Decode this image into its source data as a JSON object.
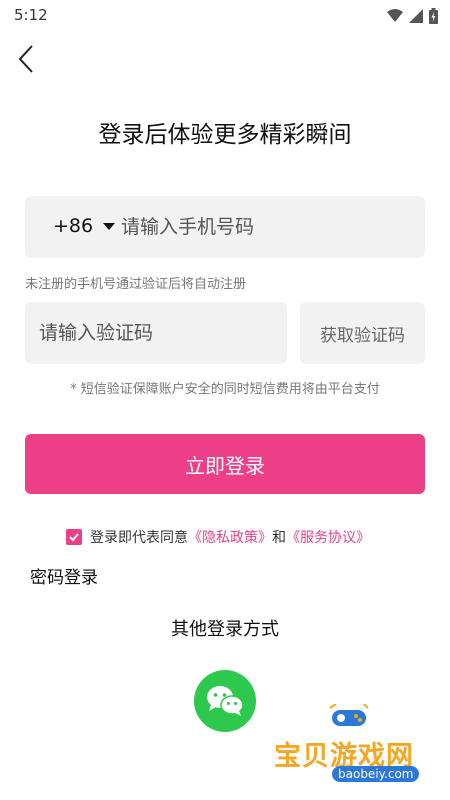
{
  "status": {
    "time": "5:12"
  },
  "title": "登录后体验更多精彩瞬间",
  "phone": {
    "country_code": "+86",
    "placeholder": "请输入手机号码"
  },
  "hint_unregistered": "未注册的手机号通过验证后将自动注册",
  "code": {
    "placeholder": "请输入验证码",
    "get_code_label": "获取验证码"
  },
  "hint_sms": "* 短信验证保障账户安全的同时短信费用将由平台支付",
  "login_button": "立即登录",
  "agreement": {
    "prefix": "登录即代表同意",
    "privacy": "《隐私政策》",
    "and": "和",
    "service": "《服务协议》"
  },
  "password_login": "密码登录",
  "other_methods": "其他登录方式",
  "watermark": {
    "text": "宝贝游戏网",
    "url": "baobeiy.com"
  },
  "colors": {
    "accent": "#ec3f88",
    "wechat": "#2dc94f"
  },
  "icons": [
    "wifi-icon",
    "signal-icon",
    "battery-icon",
    "back-arrow-icon",
    "check-icon",
    "wechat-icon",
    "gamepad-icon"
  ]
}
